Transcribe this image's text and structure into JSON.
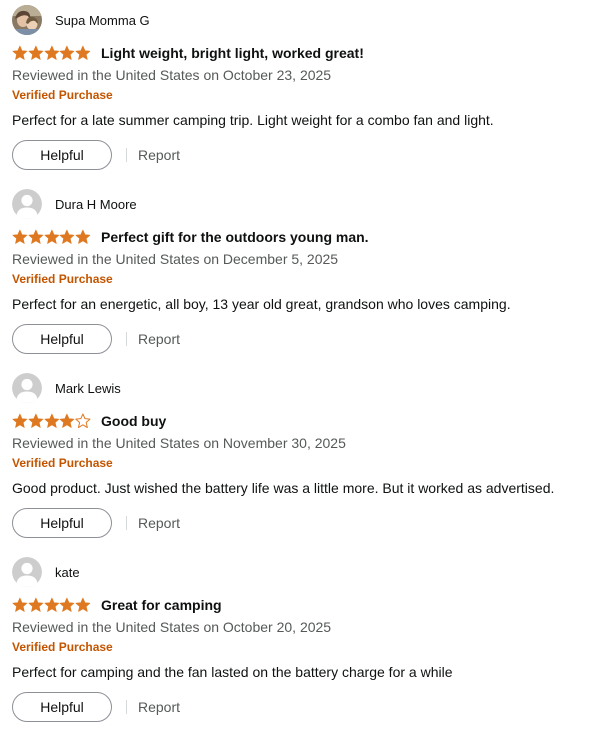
{
  "reviews": [
    {
      "reviewer": "Supa Momma G",
      "avatar_type": "photo",
      "rating": 5,
      "max_rating": 5,
      "title": "Light weight, bright light, worked great!",
      "meta": "Reviewed in the United States on October 23, 2025",
      "verified": "Verified Purchase",
      "body": "Perfect for a late summer camping trip. Light weight for a combo fan and light.",
      "helpful_label": "Helpful",
      "report_label": "Report"
    },
    {
      "reviewer": "Dura H Moore",
      "avatar_type": "default-person-icon",
      "rating": 5,
      "max_rating": 5,
      "title": "Perfect gift for the outdoors young man.",
      "meta": "Reviewed in the United States on December 5, 2025",
      "verified": "Verified Purchase",
      "body": "Perfect for an energetic, all boy, 13 year old great, grandson who loves camping.",
      "helpful_label": "Helpful",
      "report_label": "Report"
    },
    {
      "reviewer": "Mark Lewis",
      "avatar_type": "default-person-icon",
      "rating": 4,
      "max_rating": 5,
      "title": "Good buy",
      "meta": "Reviewed in the United States on November 30, 2025",
      "verified": "Verified Purchase",
      "body": "Good product. Just wished the battery life was a little more. But it worked as advertised.",
      "helpful_label": "Helpful",
      "report_label": "Report"
    },
    {
      "reviewer": "kate",
      "avatar_type": "default-person-icon",
      "rating": 5,
      "max_rating": 5,
      "title": "Great for camping",
      "meta": "Reviewed in the United States on October 20, 2025",
      "verified": "Verified Purchase",
      "body": "Perfect for camping and the fan lasted on the battery charge for a while",
      "helpful_label": "Helpful",
      "report_label": "Report"
    }
  ],
  "colors": {
    "star_filled": "#de7921",
    "star_outline": "#de7921",
    "verified": "#c45500",
    "meta_text": "#565959",
    "body_text": "#0f1111",
    "button_border": "#8d9096",
    "avatar_bg": "#cdcdcd"
  }
}
